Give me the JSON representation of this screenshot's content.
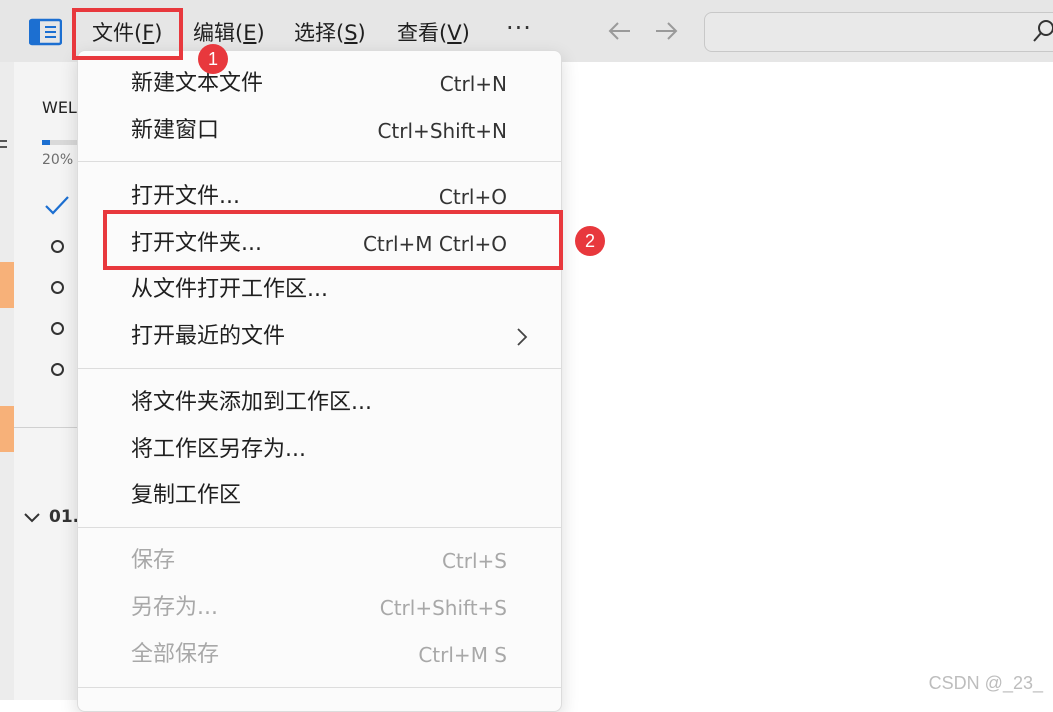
{
  "menubar": {
    "items": [
      {
        "label": "文件(",
        "accel": "F",
        "suffix": ")"
      },
      {
        "label": "编辑(",
        "accel": "E",
        "suffix": ")"
      },
      {
        "label": "选择(",
        "accel": "S",
        "suffix": ")"
      },
      {
        "label": "查看(",
        "accel": "V",
        "suffix": ")"
      }
    ],
    "more_label": "···"
  },
  "welcome": {
    "title_fragment": "WEL",
    "progress_text": "20%",
    "progress_value": 0.2,
    "section_label": "01."
  },
  "file_menu": {
    "groups": [
      [
        {
          "label": "新建文本文件",
          "shortcut": "Ctrl+N"
        },
        {
          "label": "新建窗口",
          "shortcut": "Ctrl+Shift+N"
        }
      ],
      [
        {
          "label": "打开文件...",
          "shortcut": "Ctrl+O"
        },
        {
          "label": "打开文件夹...",
          "shortcut": "Ctrl+M Ctrl+O"
        },
        {
          "label": "从文件打开工作区...",
          "shortcut": ""
        },
        {
          "label": "打开最近的文件",
          "shortcut": "",
          "submenu": true
        }
      ],
      [
        {
          "label": "将文件夹添加到工作区...",
          "shortcut": ""
        },
        {
          "label": "将工作区另存为...",
          "shortcut": ""
        },
        {
          "label": "复制工作区",
          "shortcut": ""
        }
      ],
      [
        {
          "label": "保存",
          "shortcut": "Ctrl+S",
          "disabled": true
        },
        {
          "label": "另存为...",
          "shortcut": "Ctrl+Shift+S",
          "disabled": true
        },
        {
          "label": "全部保存",
          "shortcut": "Ctrl+M S",
          "disabled": true
        }
      ]
    ]
  },
  "annotations": {
    "badge1": "1",
    "badge2": "2"
  },
  "watermark": "CSDN @_23_",
  "colors": {
    "accent": "#1c6fd1",
    "annotation": "#e8383d",
    "disabled_text": "#a8a8a8"
  }
}
